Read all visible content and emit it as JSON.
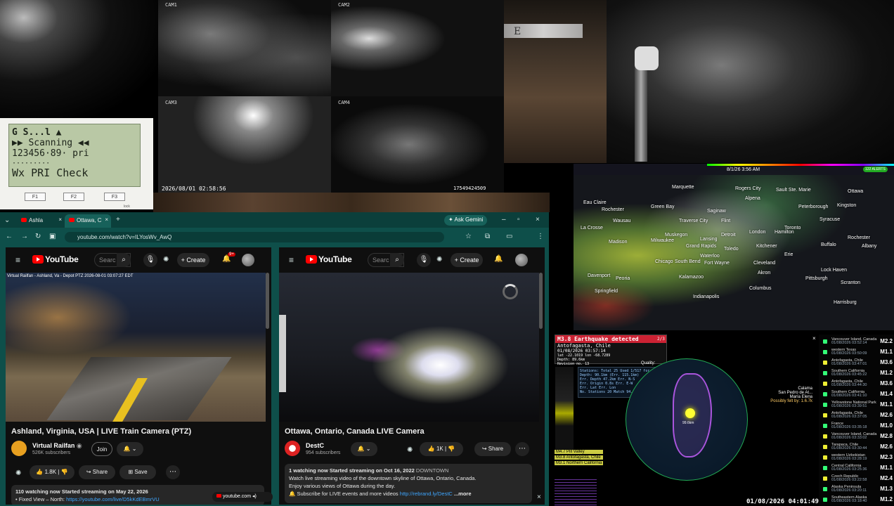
{
  "cameras": {
    "cam1": "CAM1",
    "cam2": "CAM2",
    "cam3": "CAM3",
    "cam4": "CAM4",
    "timestamp": "2026/08/01  02:58:56",
    "serial": "17549424509",
    "hud_letter": "E"
  },
  "scanner": {
    "line1": "G  S...l        ▲",
    "line2": "▶▶  Scanning   ◀◀",
    "line3": "123456·89·  pri",
    "line4": "·········",
    "line5": "Wx PRI Check",
    "keys": [
      "F1",
      "F2",
      "F3"
    ],
    "lock": "lock"
  },
  "browser": {
    "tabs": [
      {
        "label": "Ashla"
      },
      {
        "label": "Ottawa, C"
      }
    ],
    "ask_gemini": "Ask Gemini",
    "url": "youtube.com/watch?v=ILYosWv_AwQ",
    "taskbar_label": "youtube.com"
  },
  "left_video": {
    "logo": "YouTube",
    "search_placeholder": "Searc",
    "create": "Create",
    "notif_badge": "9+",
    "overlay": "Virtual Railfan - Ashland, Va - Depot PTZ  2026-08-01 03:07:27 EDT",
    "title": "Ashland, Virginia, USA | LIVE Train Camera (PTZ)",
    "channel": "Virtual Railfan",
    "subscribers": "526K subscribers",
    "join": "Join",
    "likes": "1.8K",
    "share": "Share",
    "save": "Save",
    "watching": "110 watching now  Started streaming on May 22, 2026",
    "desc_line2": "• Fixed View – North:",
    "desc_link": "https://youtube.com/live/D5kKdEBmrVU"
  },
  "right_video": {
    "logo": "YouTube",
    "search_placeholder": "Searc",
    "create": "Create",
    "title": "Ottawa, Ontario, Canada LIVE Camera",
    "channel": "DestC",
    "subscribers": "954 subscribers",
    "likes": "1K",
    "share": "Share",
    "desc_line1_a": "1 watching now  Started streaming on Oct 16, 2022",
    "desc_line1_b": "DOWNTOWN",
    "desc_line2": "Watch live streaming video of the downtown skyline of Ottawa, Ontario, Canada.",
    "desc_line3": "Enjoy various views of Ottawa during the day.",
    "desc_line4": "Subscribe for LIVE events and more videos",
    "desc_link": "http://rebrand.ly/DestC",
    "more": "...more"
  },
  "radar": {
    "datetime": "8/1/26 3:56 AM",
    "alerts": "122 ALERTS",
    "cities": [
      "Marquette",
      "Rogers City",
      "Alpena",
      "Sault Ste. Marie",
      "Ottawa",
      "Kingston",
      "Eau Claire",
      "Green Bay",
      "Saginaw",
      "Peterborough",
      "Syracuse",
      "Hamilton",
      "London",
      "Detroit",
      "Toledo",
      "Cleveland",
      "Erie",
      "Buffalo",
      "Rochester",
      "Chicago",
      "Davenport",
      "South Bend",
      "Fort Wayne",
      "Akron",
      "Pittsburgh",
      "Springfield",
      "Lock Haven",
      "Scranton",
      "Albany",
      "Peoria",
      "Indianapolis",
      "Columbus",
      "Harrisburg",
      "Milwaukee",
      "Madison",
      "La Crosse",
      "Rochester",
      "Waterloo",
      "Kitchener",
      "Toronto",
      "Wausau",
      "Traverse City",
      "Muskegon",
      "Grand Rapids",
      "Lansing",
      "Flint",
      "Kalamazoo"
    ]
  },
  "quake": {
    "alert_title": "M3.8 Earthquake detected",
    "place": "Antofagasta, Chile",
    "time": "01/08/2026 03:57:14",
    "coords": "lat -22.1019 lon -68.7289",
    "depth": "Depth: 89.6km",
    "revision": "Revision no. 13",
    "counter": "2/3",
    "stations_line": "Stations: Total 25  Used 1/517 for 1",
    "stats": [
      "Depth: 90.1km (Err. 115.1km)",
      "Err. Depth  47.2km   Err. N-S",
      "Err. Origin  0.8s    Err. E-W",
      "Err. Lat           Err. Lon",
      "No. Stations 20    Match 94.1%"
    ],
    "quality": "Quality:",
    "dist_place1": "Calama",
    "dist_place2": "San Pedro de At...",
    "dist_place3": "María Elena",
    "felt": "Possibly felt by: 1.6.7k",
    "mmi_label": "99.6km",
    "small_events": [
      "M4.7 Pill Valley",
      "M3.8 Antofagasta, Chile",
      "M3.1 Northern California"
    ],
    "clock": "01/08/2026 04:01:49",
    "list": [
      {
        "place": "Vancouver Island, Canada",
        "when": "01/08/2026 03:52:14",
        "mag": "M2.2",
        "color": "#3f7"
      },
      {
        "place": "western Texas",
        "when": "01/08/2026 03:50:09",
        "mag": "M1.1",
        "color": "#3f7"
      },
      {
        "place": "Antofagasta, Chile",
        "when": "01/08/2026 03:47:01",
        "mag": "M3.6",
        "color": "#ee3"
      },
      {
        "place": "Southern California",
        "when": "01/08/2026 03:45:22",
        "mag": "M1.2",
        "color": "#3f7"
      },
      {
        "place": "Antofagasta, Chile",
        "when": "01/08/2026 03:44:30",
        "mag": "M3.6",
        "color": "#ee3"
      },
      {
        "place": "Southern California",
        "when": "01/08/2026 03:41:10",
        "mag": "M1.4",
        "color": "#3f7"
      },
      {
        "place": "Yellowstone National Park",
        "when": "01/08/2026 03:39:51",
        "mag": "M1.1",
        "color": "#3f7"
      },
      {
        "place": "Antofagasta, Chile",
        "when": "01/08/2026 03:37:05",
        "mag": "M2.6",
        "color": "#ee3"
      },
      {
        "place": "France",
        "when": "01/08/2026 03:35:18",
        "mag": "M1.0",
        "color": "#3f7"
      },
      {
        "place": "Vancouver Island, Canada",
        "when": "01/08/2026 03:33:02",
        "mag": "M2.8",
        "color": "#ee3"
      },
      {
        "place": "Tarapaca, Chile",
        "when": "01/08/2026 03:30:44",
        "mag": "M2.6",
        "color": "#ee3"
      },
      {
        "place": "western Uzbekistan",
        "when": "01/08/2026 03:28:19",
        "mag": "M2.3",
        "color": "#ee3"
      },
      {
        "place": "Central California",
        "when": "01/08/2026 03:25:36",
        "mag": "M1.1",
        "color": "#3f7"
      },
      {
        "place": "Czech Republic",
        "when": "01/08/2026 03:22:58",
        "mag": "M2.4",
        "color": "#ee3"
      },
      {
        "place": "Alaska Peninsula",
        "when": "01/08/2026 03:20:11",
        "mag": "M1.3",
        "color": "#3f7"
      },
      {
        "place": "Southeastern Alaska",
        "when": "01/08/2026 03:18:40",
        "mag": "M1.2",
        "color": "#3f7"
      }
    ]
  }
}
